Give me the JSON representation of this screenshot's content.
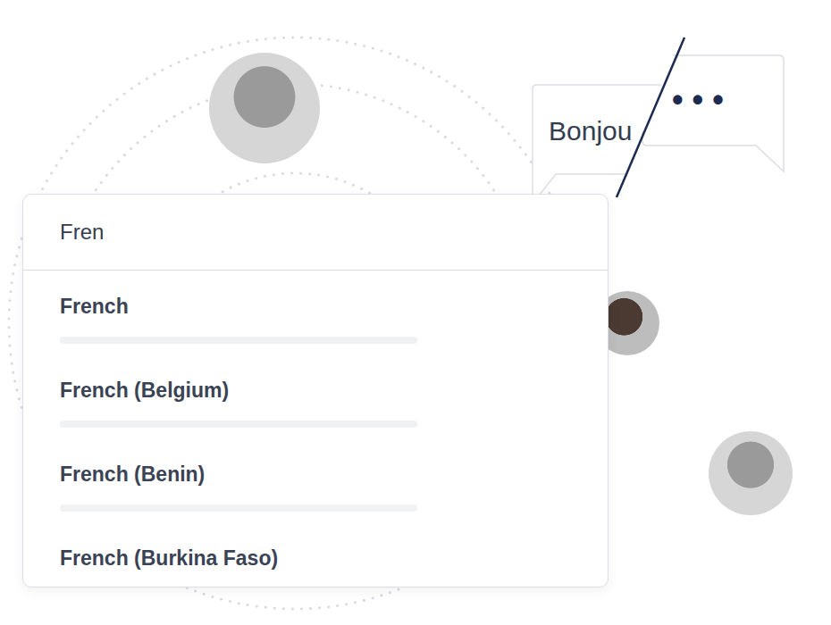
{
  "search": {
    "value": "Fren"
  },
  "options": [
    {
      "label": "French"
    },
    {
      "label": "French (Belgium)"
    },
    {
      "label": "French (Benin)"
    },
    {
      "label": "French (Burkina Faso)"
    }
  ],
  "bubbles": {
    "greeting": "Bonjou",
    "typing": "• • •"
  }
}
